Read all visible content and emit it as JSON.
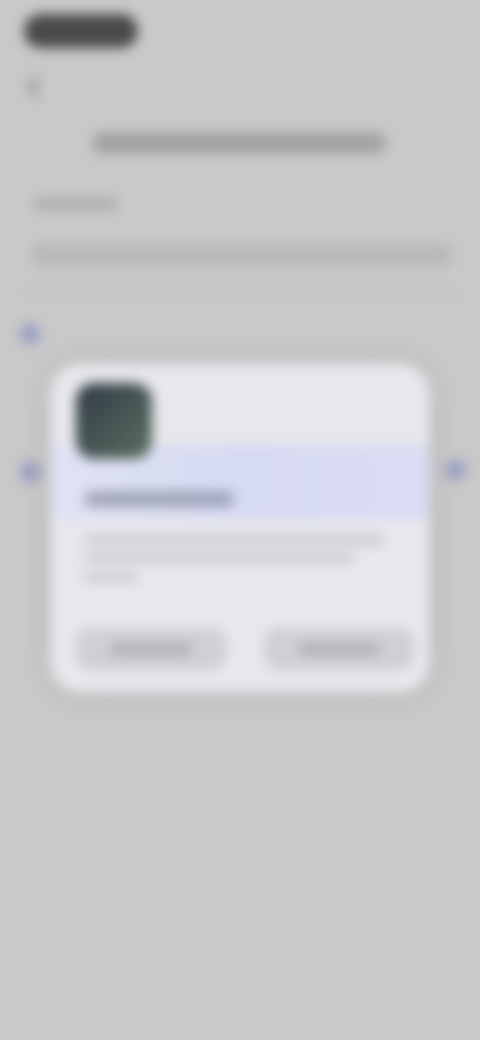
{
  "screen": {
    "background": "#c9c9c9",
    "accent": "#7c85c1"
  },
  "icons": {
    "back": "back-arrow-icon",
    "status": "status-pill-icon",
    "radio": "radio-icon",
    "app": "app-icon"
  }
}
